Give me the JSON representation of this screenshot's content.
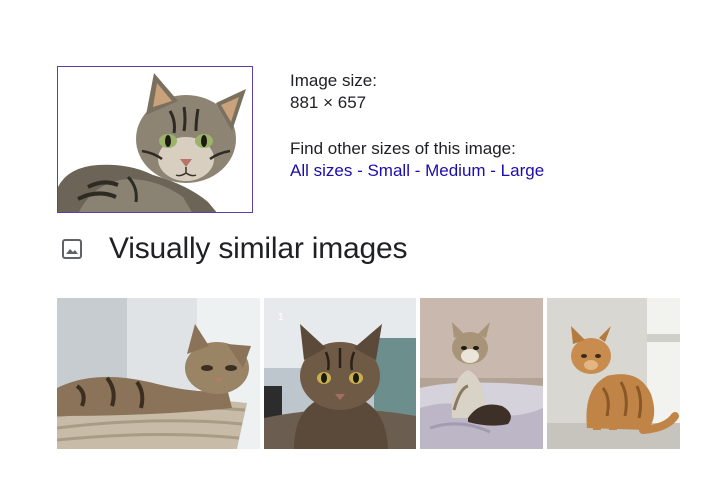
{
  "info": {
    "size_label": "Image size:",
    "size_value": "881 × 657",
    "other_sizes_label": "Find other sizes of this image:",
    "links": [
      {
        "label": "All sizes"
      },
      {
        "label": "Small"
      },
      {
        "label": "Medium"
      },
      {
        "label": "Large"
      }
    ],
    "separator": " - "
  },
  "similar": {
    "title": "Visually similar images",
    "icon": "image-icon",
    "tiles": [
      {
        "name": "similar-image-1",
        "badge": ""
      },
      {
        "name": "similar-image-2",
        "badge": "1"
      },
      {
        "name": "similar-image-3",
        "badge": ""
      },
      {
        "name": "similar-image-4",
        "badge": ""
      }
    ]
  },
  "colors": {
    "link": "#1a0dab",
    "selected_border": "#5a3fa8",
    "text": "#202124"
  }
}
